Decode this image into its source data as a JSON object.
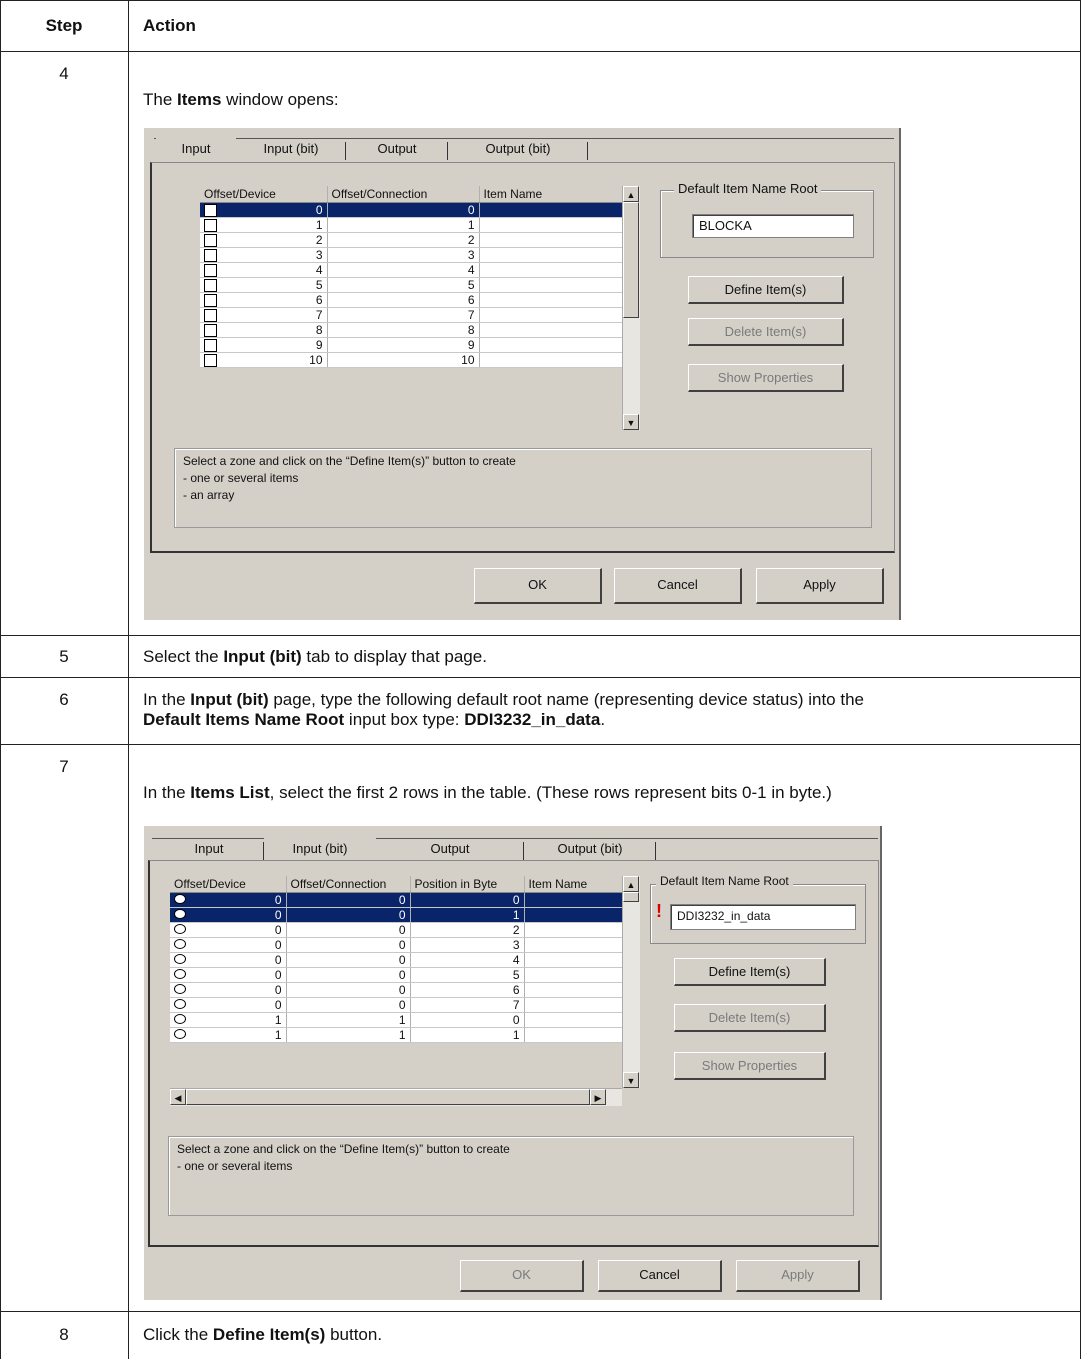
{
  "header": {
    "step": "Step",
    "action": "Action"
  },
  "rows": [
    {
      "step": "4",
      "intro": {
        "before": "The ",
        "bold": "Items",
        "after": " window opens:"
      }
    },
    {
      "step": "5",
      "text": {
        "a": "Select the ",
        "b": "Input (bit)",
        "c": " tab to display that page."
      }
    },
    {
      "step": "6",
      "text": {
        "a": "In the ",
        "b": "Input (bit)",
        "c": " page, type the following default root name (representing device status) into the",
        "d": "Default Items Name Root",
        "e": " input box type: ",
        "f": "DDI3232_in_data",
        "g": "."
      }
    },
    {
      "step": "7",
      "text": {
        "a": "In the ",
        "b": "Items List",
        "c": ", select the first 2 rows in the table. (These rows represent bits 0-1 in byte.)"
      }
    },
    {
      "step": "8",
      "text": {
        "a": "Click the ",
        "b": "Define Item(s)",
        "c": " button."
      }
    }
  ],
  "dialog1": {
    "tabs": [
      "Input",
      "Input (bit)",
      "Output",
      "Output (bit)"
    ],
    "columns": [
      "Offset/Device",
      "Offset/Connection",
      "Item Name"
    ],
    "grid_rows": [
      [
        "0",
        "0",
        ""
      ],
      [
        "1",
        "1",
        ""
      ],
      [
        "2",
        "2",
        ""
      ],
      [
        "3",
        "3",
        ""
      ],
      [
        "4",
        "4",
        ""
      ],
      [
        "5",
        "5",
        ""
      ],
      [
        "6",
        "6",
        ""
      ],
      [
        "7",
        "7",
        ""
      ],
      [
        "8",
        "8",
        ""
      ],
      [
        "9",
        "9",
        ""
      ],
      [
        "10",
        "10",
        ""
      ]
    ],
    "selected_rows": [
      0
    ],
    "group_label": "Default Item Name Root",
    "root_value": "BLOCKA",
    "buttons": {
      "define": "Define Item(s)",
      "delete": "Delete Item(s)",
      "show": "Show Properties"
    },
    "hint": [
      "Select a zone and click on the “Define Item(s)” button to create",
      "- one or several items",
      "- an array"
    ],
    "footer": {
      "ok": "OK",
      "cancel": "Cancel",
      "apply": "Apply"
    }
  },
  "dialog2": {
    "tabs": [
      "Input",
      "Input (bit)",
      "Output",
      "Output (bit)"
    ],
    "columns": [
      "Offset/Device",
      "Offset/Connection",
      "Position in Byte",
      "Item Name"
    ],
    "grid_rows": [
      [
        "0",
        "0",
        "0",
        ""
      ],
      [
        "0",
        "0",
        "1",
        ""
      ],
      [
        "0",
        "0",
        "2",
        ""
      ],
      [
        "0",
        "0",
        "3",
        ""
      ],
      [
        "0",
        "0",
        "4",
        ""
      ],
      [
        "0",
        "0",
        "5",
        ""
      ],
      [
        "0",
        "0",
        "6",
        ""
      ],
      [
        "0",
        "0",
        "7",
        ""
      ],
      [
        "1",
        "1",
        "0",
        ""
      ],
      [
        "1",
        "1",
        "1",
        ""
      ]
    ],
    "selected_rows": [
      0,
      1
    ],
    "group_label": "Default Item Name Root",
    "root_value": "DDI3232_in_data",
    "warning_glyph": "!",
    "buttons": {
      "define": "Define Item(s)",
      "delete": "Delete Item(s)",
      "show": "Show Properties"
    },
    "hint": [
      "Select a zone and click on the “Define Item(s)” button to create",
      "- one or several items"
    ],
    "footer": {
      "ok": "OK",
      "cancel": "Cancel",
      "apply": "Apply"
    }
  }
}
